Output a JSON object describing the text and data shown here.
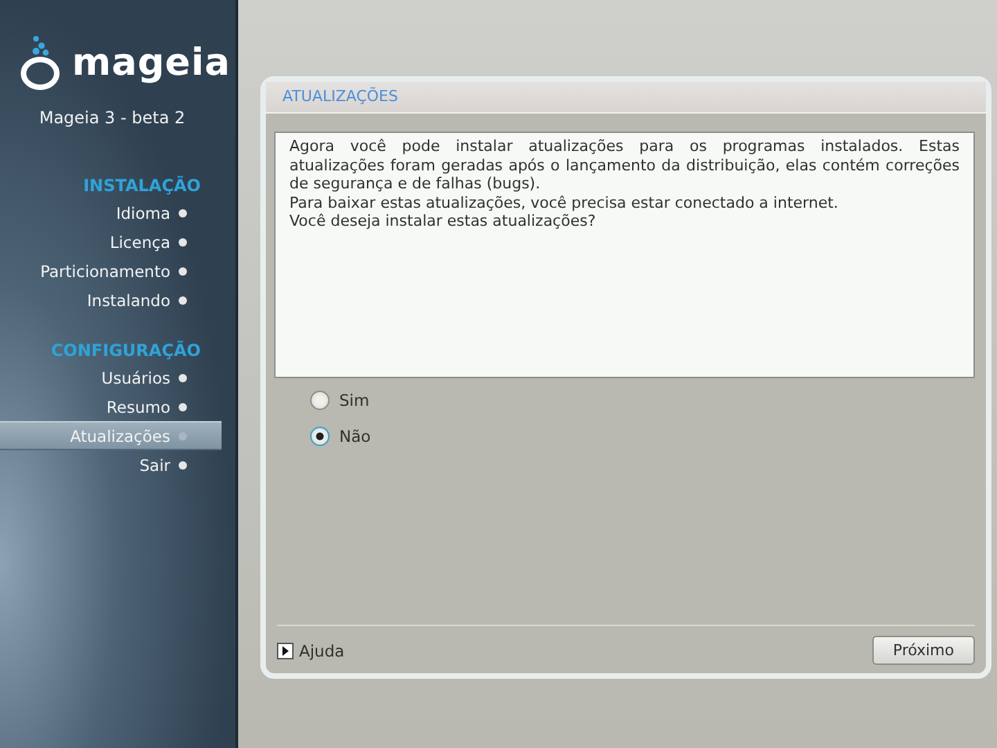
{
  "sidebar": {
    "logo": "mageia",
    "version": "Mageia 3 - beta 2",
    "sections": [
      {
        "title": "INSTALAÇÃO",
        "items": [
          {
            "label": "Idioma",
            "selected": false
          },
          {
            "label": "Licença",
            "selected": false
          },
          {
            "label": "Particionamento",
            "selected": false
          },
          {
            "label": "Instalando",
            "selected": false
          }
        ]
      },
      {
        "title": "CONFIGURAÇÃO",
        "items": [
          {
            "label": "Usuários",
            "selected": false
          },
          {
            "label": "Resumo",
            "selected": false
          },
          {
            "label": "Atualizações",
            "selected": true
          },
          {
            "label": "Sair",
            "selected": false
          }
        ]
      }
    ]
  },
  "panel": {
    "title": "ATUALIZAÇÕES",
    "message": [
      "Agora você pode instalar atualizações para os programas instalados. Estas atualizações foram geradas após o lançamento da distribuição, elas contém correções de segurança e de falhas (bugs).",
      "Para baixar estas atualizações, você precisa estar conectado a internet.",
      "Você deseja instalar estas atualizações?"
    ],
    "options": [
      {
        "label": "Sim",
        "selected": false
      },
      {
        "label": "Não",
        "selected": true
      }
    ],
    "help": "Ajuda",
    "next": "Próximo"
  }
}
